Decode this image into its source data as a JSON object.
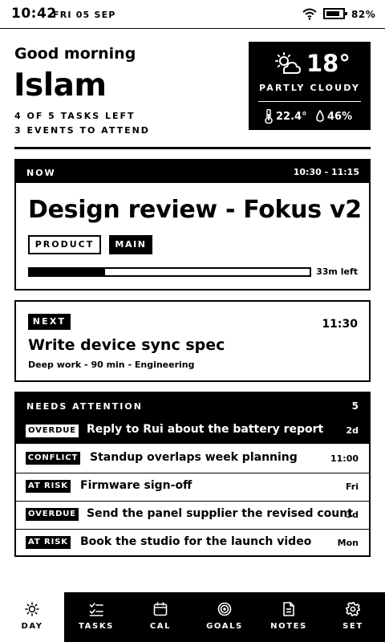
{
  "status_bar": {
    "time": "10:42",
    "date": "FRI 05 SEP",
    "battery_percent": "82%",
    "battery_level": 0.82
  },
  "greeting": {
    "salutation": "Good morning",
    "name": "Islam",
    "tasks_summary": "4 OF 5 TASKS LEFT",
    "events_summary": "3 EVENTS TO ATTEND"
  },
  "weather": {
    "icon": "partly-cloudy-icon",
    "temperature": "18°",
    "condition": "PARTLY CLOUDY",
    "indoor_temp": "22.4°",
    "humidity": "46%"
  },
  "now": {
    "label": "NOW",
    "time_range": "10:30 - 11:15",
    "title": "Design review - Fokus v2",
    "tag_primary": "PRODUCT",
    "tag_secondary": "MAIN",
    "progress_fraction": 0.27,
    "time_left": "33m left"
  },
  "next": {
    "label": "NEXT",
    "time": "11:30",
    "title": "Write device sync spec",
    "meta": "Deep work - 90 min - Engineering"
  },
  "attention": {
    "label": "NEEDS ATTENTION",
    "count": "5",
    "items": [
      {
        "badge": "OVERDUE",
        "text": "Reply to Rui about the battery report",
        "due": "2d"
      },
      {
        "badge": "CONFLICT",
        "text": "Standup overlaps week planning",
        "due": "11:00"
      },
      {
        "badge": "AT RISK",
        "text": "Firmware sign-off",
        "due": "Fri"
      },
      {
        "badge": "OVERDUE",
        "text": "Send the panel supplier the revised count",
        "due": "3d"
      },
      {
        "badge": "AT RISK",
        "text": "Book the studio for the launch video",
        "due": "Mon"
      }
    ]
  },
  "tabs": [
    {
      "label": "DAY",
      "icon": "sun-icon",
      "active": true
    },
    {
      "label": "TASKS",
      "icon": "checklist-icon",
      "active": false
    },
    {
      "label": "CAL",
      "icon": "calendar-icon",
      "active": false
    },
    {
      "label": "GOALS",
      "icon": "target-icon",
      "active": false
    },
    {
      "label": "NOTES",
      "icon": "note-icon",
      "active": false
    },
    {
      "label": "SET",
      "icon": "gear-icon",
      "active": false
    }
  ]
}
